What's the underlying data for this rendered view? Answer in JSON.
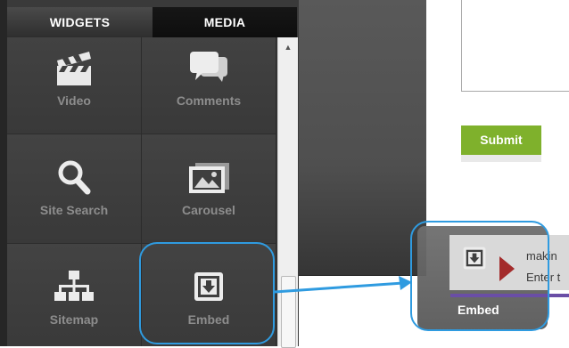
{
  "tabs": {
    "widgets": "WIDGETS",
    "media": "MEDIA"
  },
  "widgets": [
    {
      "label": "Video",
      "icon": "clapperboard-icon"
    },
    {
      "label": "Comments",
      "icon": "speech-bubbles-icon"
    },
    {
      "label": "Site Search",
      "icon": "magnifier-icon"
    },
    {
      "label": "Carousel",
      "icon": "picture-icon"
    },
    {
      "label": "Sitemap",
      "icon": "sitemap-icon"
    },
    {
      "label": "Embed",
      "icon": "embed-icon"
    }
  ],
  "form": {
    "submit_label": "Submit"
  },
  "drag_preview": {
    "label": "Embed",
    "text_line1": "makin",
    "text_line2": "Enter t"
  },
  "colors": {
    "highlight": "#2f9be0",
    "submit": "#7fb12c",
    "panel": "#3a3a3a"
  }
}
